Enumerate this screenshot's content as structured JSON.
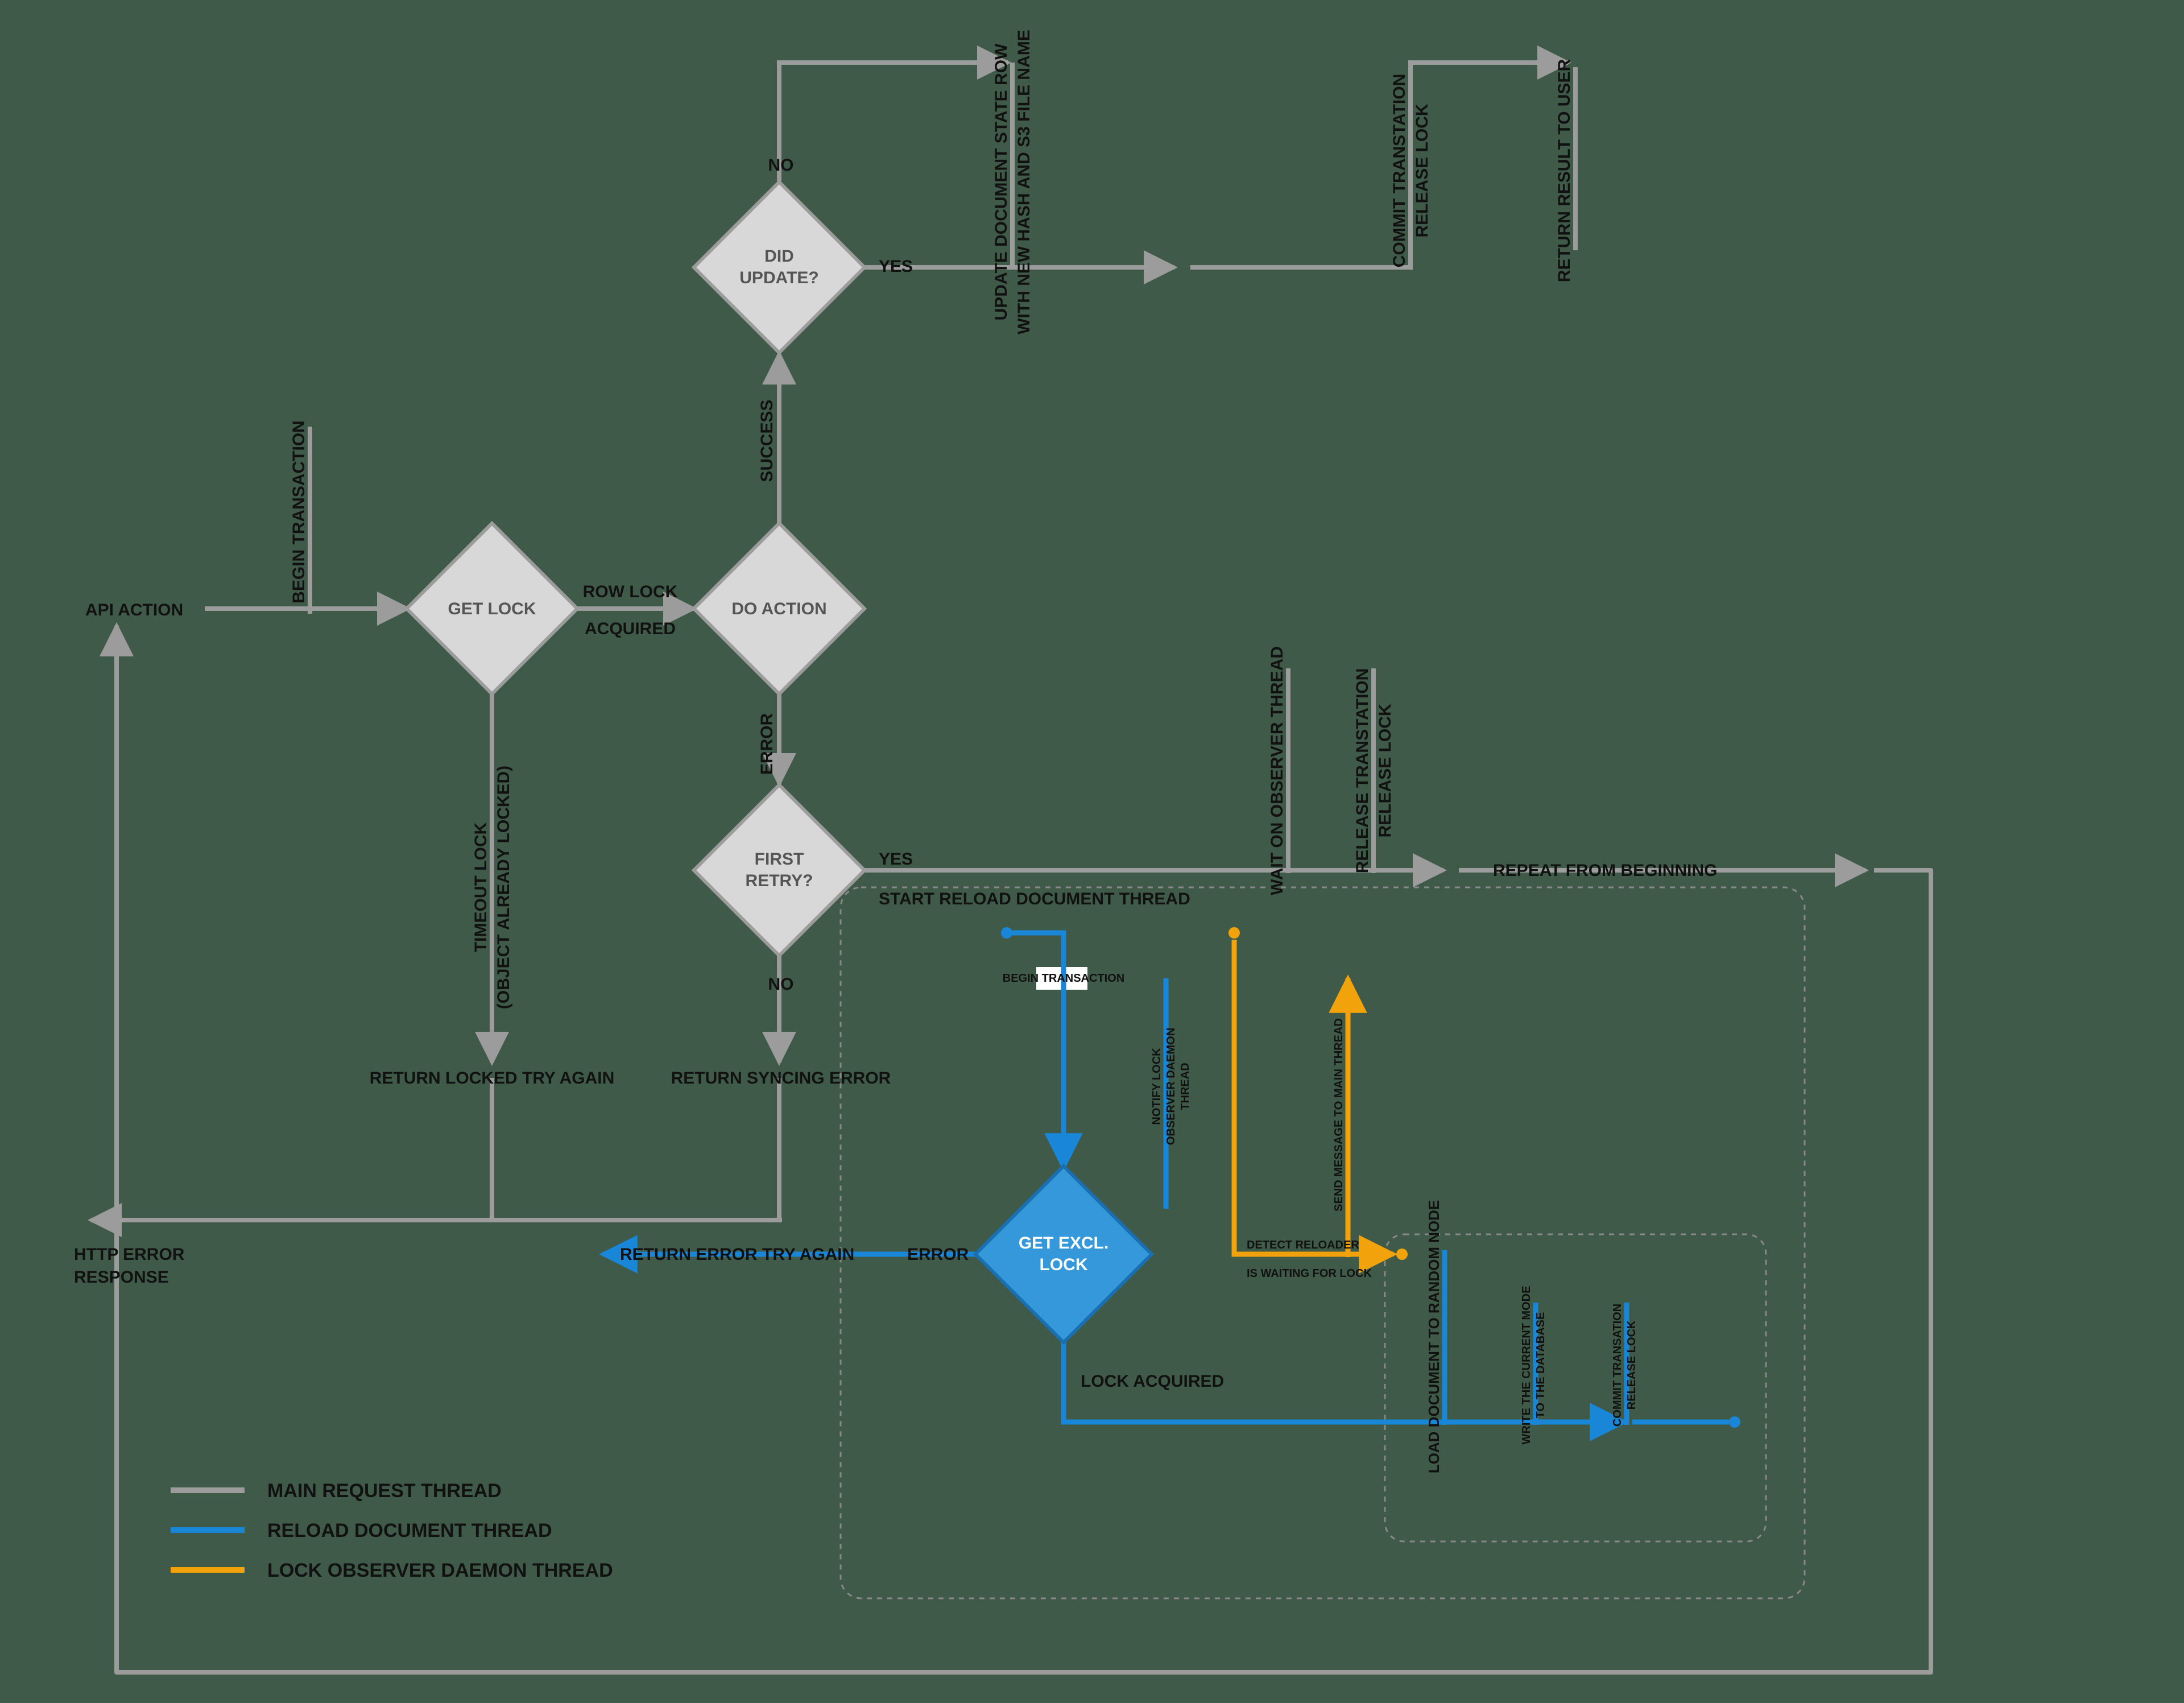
{
  "nodes": {
    "api_action": "API ACTION",
    "get_lock": "GET LOCK",
    "do_action": "DO ACTION",
    "did_update_l1": "DID",
    "did_update_l2": "UPDATE?",
    "first_retry_l1": "FIRST",
    "first_retry_l2": "RETRY?",
    "get_excl_l1": "GET EXCL.",
    "get_excl_l2": "LOCK"
  },
  "edges": {
    "begin_tx": "BEGIN TRANSACTION",
    "row_lock_l1": "ROW LOCK",
    "row_lock_l2": "ACQUIRED",
    "timeout_l1": "TIMEOUT LOCK",
    "timeout_l2": "(OBJECT ALREADY LOCKED)",
    "success": "SUCCESS",
    "error": "ERROR",
    "no": "NO",
    "yes": "YES",
    "update_row_l1": "UPDATE DOCUMENT STATE ROW",
    "update_row_l2": "WITH NEW HASH AND S3 FILE NAME",
    "commit_l1": "COMMIT TRANSTATION",
    "commit_l2": "RELEASE LOCK",
    "return_user": "RETURN RESULT TO USER",
    "return_locked": "RETURN LOCKED TRY AGAIN",
    "return_syncing": "RETURN SYNCING ERROR",
    "start_reload": "START RELOAD DOCUMENT THREAD",
    "wait_observer": "WAIT ON OBSERVER THREAD",
    "release_tx_l1": "RELEASE TRANSTATION",
    "release_tx_l2": "RELEASE LOCK",
    "repeat": "REPEAT FROM BEGINNING",
    "http_err_l1": "HTTP ERROR",
    "http_err_l2": "RESPONSE",
    "return_err_try": "RETURN ERROR TRY AGAIN",
    "error2": "ERROR",
    "begin_tx2": "BEGIN TRANSACTION",
    "notify_l1": "NOTIFY LOCK",
    "notify_l2": "OBSERVER DAEMON",
    "notify_l3": "THREAD",
    "detect_l1": "DETECT RELOADER",
    "detect_l2": "IS WAITING FOR LOCK",
    "send_msg": "SEND MESSAGE TO MAIN THREAD",
    "lock_acquired": "LOCK ACQUIRED",
    "load_random": "LOAD DOCUMENT TO RANDOM NODE",
    "write_db_l1": "WRITE THE CURRENT MODE",
    "write_db_l2": "TO THE DATABASE",
    "commit2_l1": "COMMIT TRANSATION",
    "commit2_l2": "RELEASE LOCK"
  },
  "legend": {
    "main": "MAIN REQUEST THREAD",
    "reload": "RELOAD DOCUMENT THREAD",
    "observer": "LOCK OBSERVER DAEMON THREAD"
  },
  "colors": {
    "grey": "#9c9c9c",
    "grey_fill": "#d8d8d8",
    "blue": "#1a86d8",
    "blue_fill": "#3498db",
    "orange": "#f2a30b"
  }
}
